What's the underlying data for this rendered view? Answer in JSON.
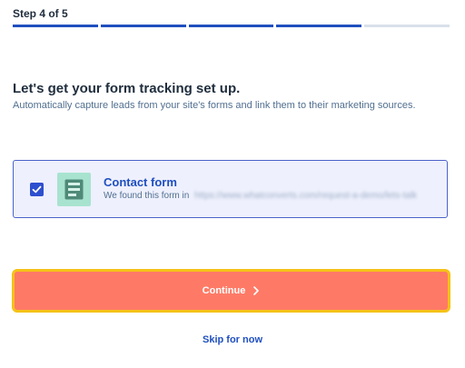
{
  "stepper": {
    "label": "Step 4 of 5",
    "current": 4,
    "total": 5
  },
  "heading": "Let's get your form tracking set up.",
  "subtext": "Automatically capture leads from your site's forms and link them to their marketing sources.",
  "form_card": {
    "checked": true,
    "title": "Contact form",
    "description": "We found this form in",
    "url": "https://www.whatconverts.com/request-a-demo/lets-talk"
  },
  "continue_label": "Continue",
  "skip_label": "Skip for now",
  "colors": {
    "accent_blue": "#1f4fbf",
    "button_coral": "#ff7a66",
    "focus_ring": "#f5c218",
    "card_bg": "#eef0fd",
    "form_icon_bg": "#a8e3cf"
  },
  "icons": {
    "checkbox": "check-icon",
    "form": "form-icon",
    "continue": "chevron-right-icon"
  }
}
